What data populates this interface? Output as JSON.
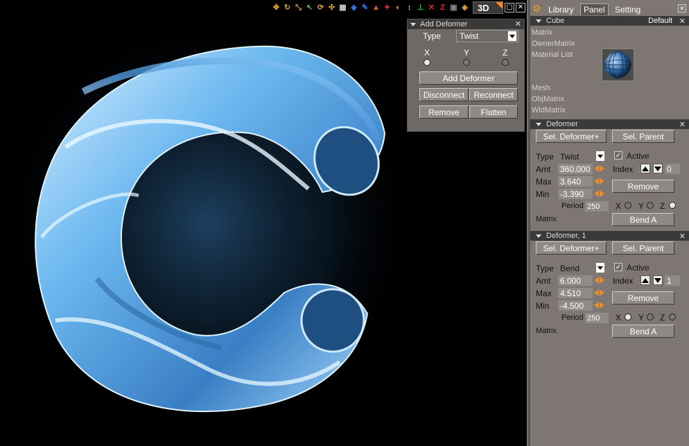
{
  "toolbar": {
    "icons": [
      "move-icon",
      "rotate-icon",
      "scale-icon",
      "select-icon",
      "refresh-icon",
      "transform-icon",
      "grid-icon",
      "cube-icon",
      "brush-icon",
      "paint-icon",
      "bone-icon",
      "magnet-icon",
      "axis-y-icon",
      "axis-icon",
      "axis-x-icon",
      "axis-z-icon",
      "camera-icon",
      "color-icon"
    ],
    "view_label": "3D"
  },
  "add_deformer": {
    "title": "Add Deformer",
    "type_label": "Type",
    "type_value": "Twist",
    "axes": [
      {
        "label": "X",
        "selected": true
      },
      {
        "label": "Y",
        "selected": false
      },
      {
        "label": "Z",
        "selected": false
      }
    ],
    "add_label": "Add Deformer",
    "disconnect_label": "Disconnect",
    "reconnect_label": "Reconnect",
    "remove_label": "Remove",
    "flatten_label": "Flatten"
  },
  "tabs": [
    {
      "label": "Library"
    },
    {
      "label": "Panel",
      "active": true
    },
    {
      "label": "Setting"
    }
  ],
  "cube": {
    "title": "Cube",
    "preset": "Default",
    "props": [
      "Matrix",
      "OwnerMatrix",
      "Material List"
    ],
    "props2": [
      "Mesh",
      "ObjMatrix",
      "WldMatrix"
    ]
  },
  "deformers": [
    {
      "title": "Deformer",
      "sel_deformer": "Sel. Deformer+",
      "sel_parent": "Sel. Parent",
      "type_label": "Type",
      "type_value": "Twist",
      "active_label": "Active",
      "active": true,
      "amt_label": "Amt",
      "amt": "360.000",
      "max_label": "Max",
      "max": "3.640",
      "min_label": "Min",
      "min": "-3.390",
      "index_label": "Index",
      "index": "0",
      "remove_label": "Remove",
      "period_label": "Period",
      "period": "250",
      "axes": [
        {
          "label": "X",
          "selected": false
        },
        {
          "label": "Y",
          "selected": false
        },
        {
          "label": "Z",
          "selected": true
        }
      ],
      "matrix_label": "Matrix",
      "matrix_value": "Bend A"
    },
    {
      "title": "Deformer, 1",
      "sel_deformer": "Sel. Deformer+",
      "sel_parent": "Sel. Parent",
      "type_label": "Type",
      "type_value": "Bend",
      "active_label": "Active",
      "active": true,
      "amt_label": "Amt",
      "amt": "6.000",
      "max_label": "Max",
      "max": "4.510",
      "min_label": "Min",
      "min": "-4.500",
      "index_label": "Index",
      "index": "1",
      "remove_label": "Remove",
      "period_label": "Period",
      "period": "250",
      "axes": [
        {
          "label": "X",
          "selected": true
        },
        {
          "label": "Y",
          "selected": false
        },
        {
          "label": "Z",
          "selected": false
        }
      ],
      "matrix_label": "Matrix",
      "matrix_value": "Bend A"
    }
  ],
  "colors": {
    "accent": "#f08a20",
    "panel": "#7d7672",
    "title_bar": "#3c3a38",
    "mesh": "#7ec8ff"
  }
}
